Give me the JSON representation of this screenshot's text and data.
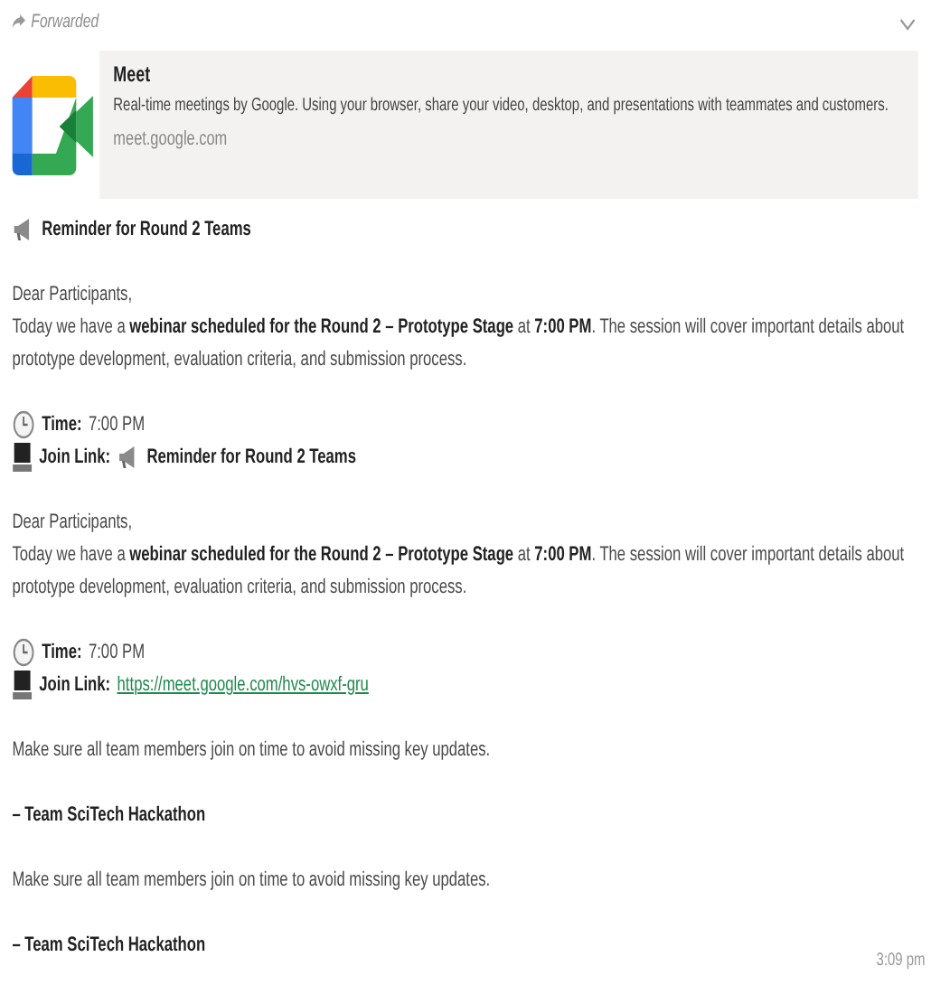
{
  "forwarded_label": "Forwarded",
  "link_preview": {
    "title": "Meet",
    "description": "Real-time meetings by Google. Using your browser, share your video, desktop, and presentations with teammates and customers.",
    "domain": "meet.google.com"
  },
  "message": [
    {
      "kind": "heading",
      "text": "Reminder for Round 2 Teams"
    },
    {
      "kind": "paragraph",
      "lines": [
        "Dear Participants,",
        "Today we have a **webinar scheduled for the Round 2 – Prototype Stage** at **7:00 PM**. The session will cover important details about prototype development, evaluation criteria, and submission process."
      ]
    },
    {
      "kind": "details",
      "items": [
        {
          "kind": "time",
          "label": "Time:",
          "value": {
            "kind": "plain",
            "text": "7:00 PM"
          }
        },
        {
          "kind": "join",
          "label": "Join Link:",
          "value": {
            "kind": "announcement",
            "text": "Reminder for Round 2 Teams"
          }
        }
      ]
    },
    {
      "kind": "paragraph",
      "lines": [
        "Dear Participants,",
        "Today we have a **webinar scheduled for the Round 2 – Prototype Stage** at **7:00 PM**. The session will cover important details about prototype development, evaluation criteria, and submission process."
      ]
    },
    {
      "kind": "details",
      "items": [
        {
          "kind": "time",
          "label": "Time:",
          "value": {
            "kind": "plain",
            "text": "7:00 PM"
          }
        },
        {
          "kind": "join",
          "label": "Join Link:",
          "value": {
            "kind": "link",
            "text": "https://meet.google.com/hvs-owxf-gru"
          }
        }
      ]
    },
    {
      "kind": "paragraph",
      "lines": [
        "Make sure all team members join on time to avoid missing key updates."
      ]
    },
    {
      "kind": "signature",
      "text": "– Team SciTech Hackathon"
    },
    {
      "kind": "paragraph",
      "lines": [
        "Make sure all team members join on time to avoid missing key updates."
      ]
    },
    {
      "kind": "signature",
      "text": "– Team SciTech Hackathon"
    }
  ],
  "timestamp": "3:09 pm"
}
